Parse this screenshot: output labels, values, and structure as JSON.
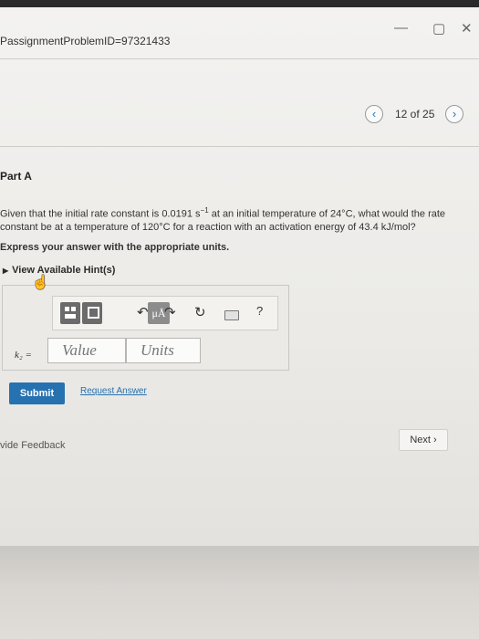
{
  "window": {
    "minimize_glyph": "—",
    "maximize_glyph": "▢",
    "close_glyph": "✕"
  },
  "url_text": "PassignmentProblemID=97321433",
  "navigation": {
    "prev_glyph": "‹",
    "next_glyph": "›",
    "counter": "12 of 25"
  },
  "part": {
    "title": "Part A"
  },
  "question": {
    "text_before_unit": "Given that the initial rate constant is 0.0191 s",
    "unit_superscript": "−1",
    "text_after_unit": " at an initial temperature of 24°C, what would the rate constant be at a temperature of 120°C for a reaction with an activation energy of 43.4 kJ/mol?",
    "instruction": "Express your answer with the appropriate units."
  },
  "hints": {
    "label": "View Available Hint(s)"
  },
  "toolbar": {
    "mu_label": "μÅ",
    "undo_glyph": "↶",
    "redo_glyph": "↷",
    "reset_glyph": "↻",
    "help_glyph": "?"
  },
  "answer": {
    "variable_label": "k₂ =",
    "value_placeholder": "Value",
    "units_placeholder": "Units"
  },
  "actions": {
    "submit_label": "Submit",
    "request_label": "Request Answer"
  },
  "footer": {
    "feedback_label": "vide Feedback",
    "next_label": "Next ›"
  },
  "colors": {
    "accent_blue": "#2672b0",
    "dark_button": "#6b6b6b"
  }
}
